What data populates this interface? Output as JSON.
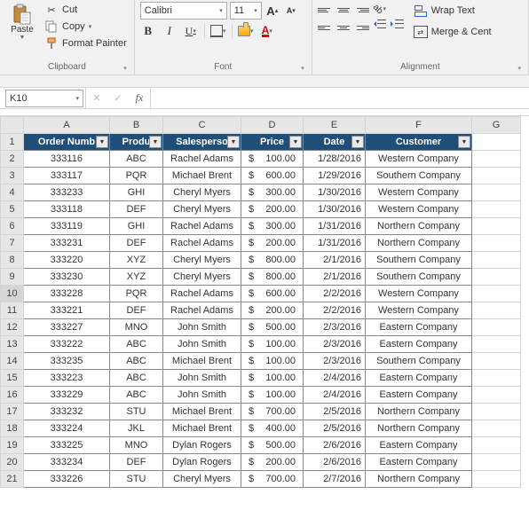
{
  "ribbon": {
    "clipboard": {
      "label": "Clipboard",
      "paste": "Paste",
      "cut": "Cut",
      "copy": "Copy",
      "format_painter": "Format Painter"
    },
    "font": {
      "label": "Font",
      "name": "Calibri",
      "size": "11",
      "bold": "B",
      "italic": "I",
      "underline": "U",
      "fontcolor_glyph": "A"
    },
    "alignment": {
      "label": "Alignment",
      "wrap": "Wrap Text",
      "merge": "Merge & Cent"
    }
  },
  "namebox": "K10",
  "formula": "",
  "columns": [
    "A",
    "B",
    "C",
    "D",
    "E",
    "F",
    "G"
  ],
  "headers": [
    "Order Numb",
    "Produ",
    "Salesperso",
    "Price",
    "Date",
    "Customer"
  ],
  "selected_row": 10,
  "rows": [
    {
      "n": "2",
      "order": "333116",
      "prod": "ABC",
      "sales": "Rachel Adams",
      "price": "100.00",
      "date": "1/28/2016",
      "cust": "Western Company"
    },
    {
      "n": "3",
      "order": "333117",
      "prod": "PQR",
      "sales": "Michael Brent",
      "price": "600.00",
      "date": "1/29/2016",
      "cust": "Southern Company"
    },
    {
      "n": "4",
      "order": "333233",
      "prod": "GHI",
      "sales": "Cheryl Myers",
      "price": "300.00",
      "date": "1/30/2016",
      "cust": "Western Company"
    },
    {
      "n": "5",
      "order": "333118",
      "prod": "DEF",
      "sales": "Cheryl Myers",
      "price": "200.00",
      "date": "1/30/2016",
      "cust": "Western Company"
    },
    {
      "n": "6",
      "order": "333119",
      "prod": "GHI",
      "sales": "Rachel Adams",
      "price": "300.00",
      "date": "1/31/2016",
      "cust": "Northern Company"
    },
    {
      "n": "7",
      "order": "333231",
      "prod": "DEF",
      "sales": "Rachel Adams",
      "price": "200.00",
      "date": "1/31/2016",
      "cust": "Northern Company"
    },
    {
      "n": "8",
      "order": "333220",
      "prod": "XYZ",
      "sales": "Cheryl Myers",
      "price": "800.00",
      "date": "2/1/2016",
      "cust": "Southern Company"
    },
    {
      "n": "9",
      "order": "333230",
      "prod": "XYZ",
      "sales": "Cheryl Myers",
      "price": "800.00",
      "date": "2/1/2016",
      "cust": "Southern Company"
    },
    {
      "n": "10",
      "order": "333228",
      "prod": "PQR",
      "sales": "Rachel Adams",
      "price": "600.00",
      "date": "2/2/2016",
      "cust": "Western Company"
    },
    {
      "n": "11",
      "order": "333221",
      "prod": "DEF",
      "sales": "Rachel Adams",
      "price": "200.00",
      "date": "2/2/2016",
      "cust": "Western Company"
    },
    {
      "n": "12",
      "order": "333227",
      "prod": "MNO",
      "sales": "John Smith",
      "price": "500.00",
      "date": "2/3/2016",
      "cust": "Eastern Company"
    },
    {
      "n": "13",
      "order": "333222",
      "prod": "ABC",
      "sales": "John Smith",
      "price": "100.00",
      "date": "2/3/2016",
      "cust": "Eastern Company"
    },
    {
      "n": "14",
      "order": "333235",
      "prod": "ABC",
      "sales": "Michael Brent",
      "price": "100.00",
      "date": "2/3/2016",
      "cust": "Southern Company"
    },
    {
      "n": "15",
      "order": "333223",
      "prod": "ABC",
      "sales": "John Smith",
      "price": "100.00",
      "date": "2/4/2016",
      "cust": "Eastern Company"
    },
    {
      "n": "16",
      "order": "333229",
      "prod": "ABC",
      "sales": "John Smith",
      "price": "100.00",
      "date": "2/4/2016",
      "cust": "Eastern Company"
    },
    {
      "n": "17",
      "order": "333232",
      "prod": "STU",
      "sales": "Michael Brent",
      "price": "700.00",
      "date": "2/5/2016",
      "cust": "Northern Company"
    },
    {
      "n": "18",
      "order": "333224",
      "prod": "JKL",
      "sales": "Michael Brent",
      "price": "400.00",
      "date": "2/5/2016",
      "cust": "Northern Company"
    },
    {
      "n": "19",
      "order": "333225",
      "prod": "MNO",
      "sales": "Dylan Rogers",
      "price": "500.00",
      "date": "2/6/2016",
      "cust": "Eastern Company"
    },
    {
      "n": "20",
      "order": "333234",
      "prod": "DEF",
      "sales": "Dylan Rogers",
      "price": "200.00",
      "date": "2/6/2016",
      "cust": "Eastern Company"
    },
    {
      "n": "21",
      "order": "333226",
      "prod": "STU",
      "sales": "Cheryl Myers",
      "price": "700.00",
      "date": "2/7/2016",
      "cust": "Northern Company"
    }
  ]
}
